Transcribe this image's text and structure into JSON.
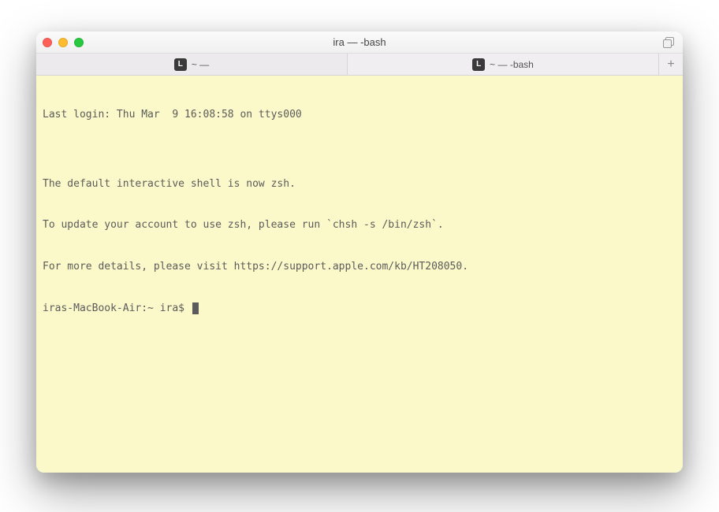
{
  "window": {
    "title": "ira — -bash"
  },
  "tabs": [
    {
      "icon": "L",
      "label": "~ —"
    },
    {
      "icon": "L",
      "label": "~ — -bash"
    }
  ],
  "terminal": {
    "lines": [
      "Last login: Thu Mar  9 16:08:58 on ttys000",
      "",
      "The default interactive shell is now zsh.",
      "To update your account to use zsh, please run `chsh -s /bin/zsh`.",
      "For more details, please visit https://support.apple.com/kb/HT208050."
    ],
    "prompt": "iras-MacBook-Air:~ ira$ "
  }
}
